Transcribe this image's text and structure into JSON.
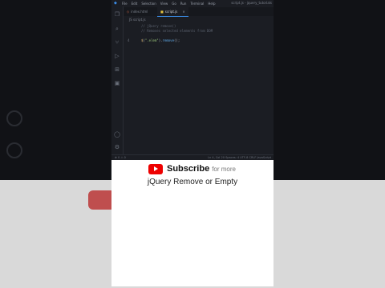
{
  "editor": {
    "menu": [
      "File",
      "Edit",
      "Selection",
      "View",
      "Go",
      "Run",
      "Terminal",
      "Help"
    ],
    "window_title": "script.js - jquery_tutorials",
    "tabs": [
      {
        "label": "index.html",
        "active": false
      },
      {
        "label": "script.js",
        "active": true
      }
    ],
    "close_glyph": "×",
    "breadcrumb": "JS script.js",
    "comment_lines": [
      "// jQuery remove()",
      "// Removes selected elements from DOM"
    ],
    "code": {
      "line_number": "4",
      "fn": "$",
      "open": "(",
      "selector": "\".elem\"",
      "close": ")",
      "dot": ".",
      "method": "remove",
      "call": "();"
    },
    "status_left": "⊗ 0 ⚠ 0",
    "status_right": "Ln 4, Col 20  Spaces: 4  UTF-8  CRLF  JavaScript"
  },
  "promo": {
    "subscribe": "Subscribe",
    "for_more": "for more",
    "title": "jQuery Remove or Empty"
  }
}
